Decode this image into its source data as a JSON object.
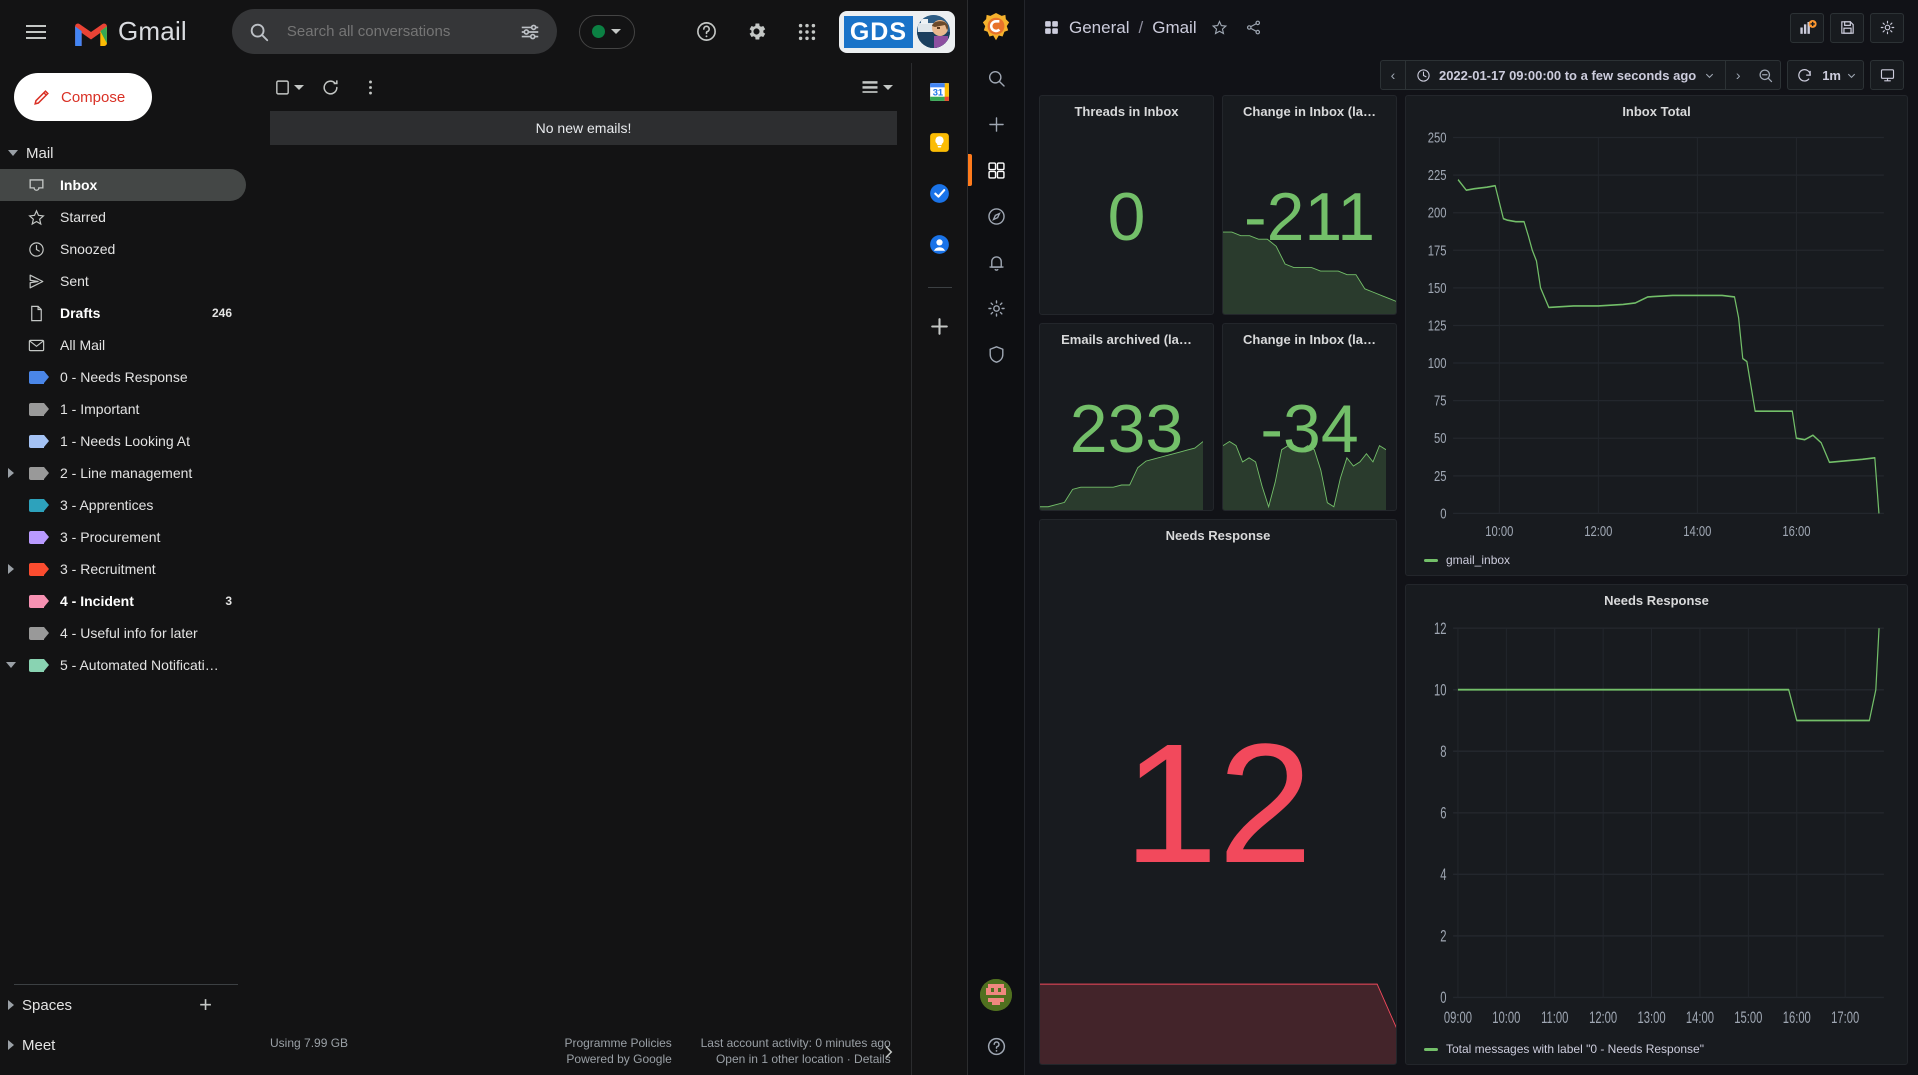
{
  "gmail": {
    "brand": "Gmail",
    "search": {
      "placeholder": "Search all conversations",
      "value": ""
    },
    "account_badge": {
      "text": "GDS"
    },
    "compose_label": "Compose",
    "toolbar": {
      "empty_message": "No new emails!"
    },
    "nav_sections": {
      "mail": "Mail",
      "spaces": "Spaces",
      "meet": "Meet"
    },
    "nav_items": [
      {
        "label": "Inbox",
        "count": "",
        "icon": "inbox-icon",
        "color": "",
        "expandable": false,
        "active": true,
        "bold": true
      },
      {
        "label": "Starred",
        "count": "",
        "icon": "star-icon",
        "color": "",
        "expandable": false,
        "active": false,
        "bold": false
      },
      {
        "label": "Snoozed",
        "count": "",
        "icon": "clock-icon",
        "color": "",
        "expandable": false,
        "active": false,
        "bold": false
      },
      {
        "label": "Sent",
        "count": "",
        "icon": "send-icon",
        "color": "",
        "expandable": false,
        "active": false,
        "bold": false
      },
      {
        "label": "Drafts",
        "count": "246",
        "icon": "draft-icon",
        "color": "",
        "expandable": false,
        "active": false,
        "bold": true
      },
      {
        "label": "All Mail",
        "count": "",
        "icon": "mail-icon",
        "color": "",
        "expandable": false,
        "active": false,
        "bold": false
      },
      {
        "label": "0 - Needs Response",
        "count": "",
        "icon": "label-icon",
        "color": "#4a86e8",
        "expandable": false,
        "active": false,
        "bold": false
      },
      {
        "label": "1 - Important",
        "count": "",
        "icon": "label-icon",
        "color": "#999999",
        "expandable": false,
        "active": false,
        "bold": false
      },
      {
        "label": "1 - Needs Looking At",
        "count": "",
        "icon": "label-icon",
        "color": "#a4c2f4",
        "expandable": false,
        "active": false,
        "bold": false
      },
      {
        "label": "2 - Line management",
        "count": "",
        "icon": "label-icon",
        "color": "#999999",
        "expandable": true,
        "active": false,
        "bold": false
      },
      {
        "label": "3 - Apprentices",
        "count": "",
        "icon": "label-icon",
        "color": "#2da2bc",
        "expandable": false,
        "active": false,
        "bold": false
      },
      {
        "label": "3 - Procurement",
        "count": "",
        "icon": "label-icon",
        "color": "#b99aff",
        "expandable": false,
        "active": false,
        "bold": false
      },
      {
        "label": "3 - Recruitment",
        "count": "",
        "icon": "label-icon",
        "color": "#fb4c2f",
        "expandable": true,
        "active": false,
        "bold": false
      },
      {
        "label": "4 - Incident",
        "count": "3",
        "icon": "label-icon",
        "color": "#f691b2",
        "expandable": false,
        "active": false,
        "bold": true
      },
      {
        "label": "4 - Useful info for later",
        "count": "",
        "icon": "label-icon",
        "color": "#999999",
        "expandable": false,
        "active": false,
        "bold": false
      },
      {
        "label": "5 - Automated Notificati…",
        "count": "",
        "icon": "label-icon",
        "color": "#89d3b2",
        "expandable": true,
        "active": false,
        "bold": false
      }
    ],
    "footer": {
      "storage": "Using 7.99 GB",
      "policies": "Programme Policies",
      "powered": "Powered by Google",
      "activity": "Last account activity: 0 minutes ago",
      "details": "Open in 1 other location · Details"
    },
    "side_rail": [
      {
        "icon": "google-calendar-icon",
        "label": "31"
      },
      {
        "icon": "google-keep-icon",
        "label": ""
      },
      {
        "icon": "google-tasks-icon",
        "label": ""
      },
      {
        "icon": "google-contacts-icon",
        "label": ""
      },
      {
        "icon": "add-app-icon",
        "label": ""
      }
    ]
  },
  "grafana": {
    "breadcrumb_folder": "General",
    "breadcrumb_sep": "/",
    "breadcrumb_dashboard": "Gmail",
    "time_range": "2022-01-17 09:00:00 to a few seconds ago",
    "refresh_interval": "1m",
    "nav_items": [
      {
        "icon": "search-icon",
        "name": "search",
        "active": false
      },
      {
        "icon": "plus-icon",
        "name": "create",
        "active": false
      },
      {
        "icon": "dashboards-icon",
        "name": "dashboards",
        "active": true
      },
      {
        "icon": "compass-icon",
        "name": "explore",
        "active": false
      },
      {
        "icon": "bell-icon",
        "name": "alerting",
        "active": false
      },
      {
        "icon": "gear-icon",
        "name": "configuration",
        "active": false
      },
      {
        "icon": "shield-icon",
        "name": "server-admin",
        "active": false
      }
    ],
    "top_buttons": [
      {
        "icon": "add-panel-icon",
        "name": "add-panel"
      },
      {
        "icon": "save-icon",
        "name": "save-dashboard"
      },
      {
        "icon": "gear-icon",
        "name": "dashboard-settings"
      }
    ],
    "colors": {
      "green": "#73bf69",
      "red": "#f2495c",
      "panel_bg": "#181b1f",
      "accent": "#ff7b1c"
    },
    "stats": [
      {
        "title": "Threads in Inbox",
        "value": "0",
        "color": "#73bf69",
        "has_spark": false
      },
      {
        "title": "Change in Inbox (la…",
        "value": "-211",
        "color": "#73bf69",
        "has_spark": true
      },
      {
        "title": "Emails archived (la…",
        "value": "233",
        "color": "#73bf69",
        "has_spark": true
      },
      {
        "title": "Change in Inbox (la…",
        "value": "-34",
        "color": "#73bf69",
        "has_spark": true
      }
    ],
    "needs_response_stat": {
      "title": "Needs Response",
      "value": "12",
      "color": "#f2495c"
    }
  },
  "chart_data": [
    {
      "type": "line",
      "title": "Inbox Total",
      "xlabel": "",
      "ylabel": "",
      "ylim": [
        0,
        250
      ],
      "yticks": [
        0,
        25,
        50,
        75,
        100,
        125,
        150,
        175,
        200,
        225,
        250
      ],
      "xticks": [
        "10:00",
        "12:00",
        "14:00",
        "16:00"
      ],
      "grid": true,
      "legend": [
        "gmail_inbox"
      ],
      "legend_position": "bottom-left",
      "series": [
        {
          "name": "gmail_inbox",
          "color": "#73bf69",
          "x": [
            "09:10",
            "09:20",
            "09:30",
            "09:45",
            "09:55",
            "10:05",
            "10:10",
            "10:20",
            "10:30",
            "10:35",
            "10:40",
            "10:45",
            "10:50",
            "11:00",
            "11:30",
            "12:00",
            "12:30",
            "12:45",
            "13:00",
            "13:30",
            "14:00",
            "14:30",
            "14:45",
            "14:50",
            "14:55",
            "15:00",
            "15:10",
            "15:40",
            "15:55",
            "16:00",
            "16:10",
            "16:20",
            "16:30",
            "16:40",
            "17:00",
            "17:20",
            "17:35",
            "17:40"
          ],
          "values": [
            222,
            215,
            216,
            217,
            218,
            196,
            195,
            194,
            194,
            185,
            175,
            168,
            150,
            137,
            138,
            138,
            139,
            140,
            144,
            145,
            145,
            145,
            144,
            130,
            103,
            101,
            68,
            68,
            68,
            50,
            49,
            52,
            47,
            34,
            35,
            36,
            37,
            0
          ]
        }
      ]
    },
    {
      "type": "line",
      "title": "Needs Response",
      "xlabel": "",
      "ylabel": "",
      "ylim": [
        0,
        12
      ],
      "yticks": [
        0,
        2,
        4,
        6,
        8,
        10,
        12
      ],
      "xticks": [
        "09:00",
        "10:00",
        "11:00",
        "12:00",
        "13:00",
        "14:00",
        "15:00",
        "16:00",
        "17:00"
      ],
      "grid": true,
      "legend": [
        "Total messages with label \"0 - Needs Response\""
      ],
      "legend_position": "bottom-left",
      "series": [
        {
          "name": "Total messages with label \"0 - Needs Response\"",
          "color": "#73bf69",
          "x": [
            "09:00",
            "10:00",
            "11:00",
            "12:00",
            "13:00",
            "14:00",
            "15:00",
            "15:50",
            "16:00",
            "17:00",
            "17:30",
            "17:38",
            "17:42"
          ],
          "values": [
            10,
            10,
            10,
            10,
            10,
            10,
            10,
            10,
            9,
            9,
            9,
            10,
            12
          ]
        }
      ]
    },
    {
      "type": "area",
      "title": "Change in Inbox (la…",
      "sparkline": true,
      "color": "#73bf69",
      "values": [
        0,
        0,
        -1,
        -1,
        -2,
        -2,
        -4,
        -9,
        -10,
        -10,
        -10,
        -11,
        -11,
        -11,
        -12,
        -12,
        -16,
        -17,
        -18,
        -19,
        -20,
        -21,
        -22
      ]
    },
    {
      "type": "area",
      "title": "Emails archived (la…",
      "sparkline": true,
      "color": "#73bf69",
      "values": [
        0,
        0,
        1,
        2,
        8,
        9,
        9,
        9,
        9,
        9,
        10,
        10,
        18,
        21,
        22,
        23,
        24,
        25,
        26,
        27,
        30
      ]
    },
    {
      "type": "area",
      "title": "Change in Inbox (la…",
      "sparkline": true,
      "color": "#73bf69",
      "values": [
        6,
        7,
        6,
        2,
        3,
        2,
        -4,
        -9,
        -3,
        5,
        6,
        6,
        5,
        6,
        5,
        0,
        -8,
        -9,
        -2,
        3,
        1,
        2,
        4,
        2,
        6,
        5
      ]
    },
    {
      "type": "area",
      "title": "Needs Response",
      "sparkline": true,
      "color": "#f2495c",
      "values": [
        10,
        10,
        10,
        10,
        10,
        10,
        10,
        10,
        10,
        10,
        10,
        10,
        9,
        9,
        9,
        9,
        9,
        12
      ]
    }
  ]
}
